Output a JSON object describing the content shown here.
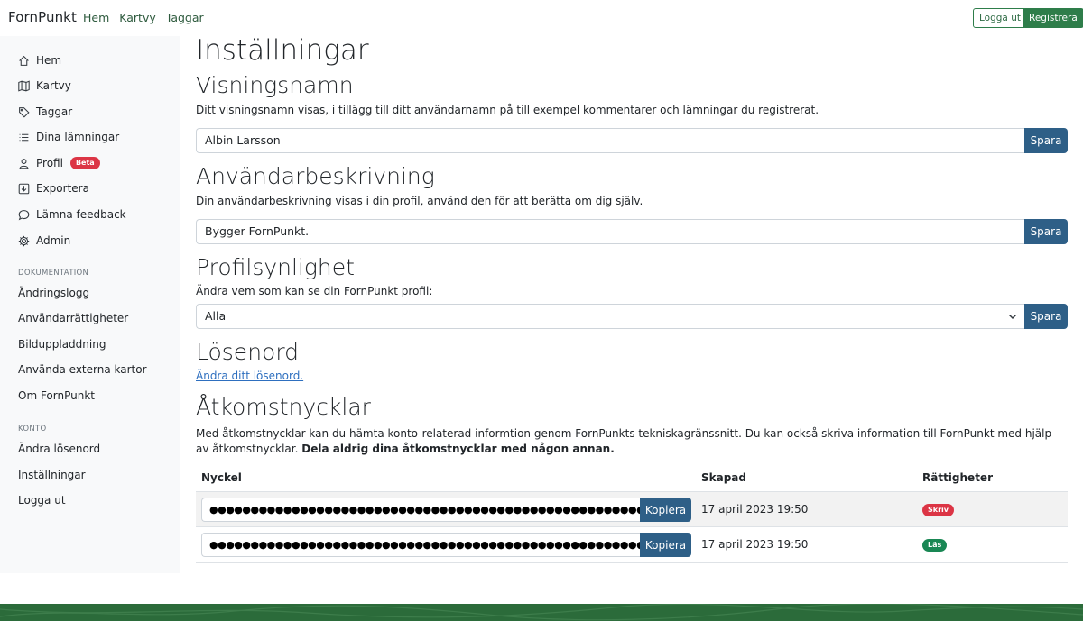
{
  "navbar": {
    "brand": "FornPunkt",
    "links": [
      "Hem",
      "Kartvy",
      "Taggar"
    ],
    "logout": "Logga ut",
    "register": "Registrera"
  },
  "sidebar": {
    "items": [
      {
        "label": "Hem",
        "icon": "home-icon"
      },
      {
        "label": "Kartvy",
        "icon": "map-icon"
      },
      {
        "label": "Taggar",
        "icon": "tag-icon"
      },
      {
        "label": "Dina lämningar",
        "icon": "list-icon"
      },
      {
        "label": "Profil",
        "icon": "user-icon",
        "badge": "Beta"
      },
      {
        "label": "Exportera",
        "icon": "download-icon"
      },
      {
        "label": "Lämna feedback",
        "icon": "chat-icon"
      },
      {
        "label": "Admin",
        "icon": "gear-icon"
      }
    ],
    "doc_heading": "DOKUMENTATION",
    "doc_links": [
      "Ändringslogg",
      "Användarrättigheter",
      "Bilduppladdning",
      "Använda externa kartor",
      "Om FornPunkt"
    ],
    "account_heading": "KONTO",
    "account_links": [
      "Ändra lösenord",
      "Inställningar",
      "Logga ut"
    ]
  },
  "main": {
    "title": "Inställningar",
    "display_name": {
      "heading": "Visningsnamn",
      "description": "Ditt visningsnamn visas, i tillägg till ditt användarnamn på till exempel kommentarer och lämningar du registrerat.",
      "value": "Albin Larsson",
      "save": "Spara"
    },
    "user_description": {
      "heading": "Användarbeskrivning",
      "description": "Din användarbeskrivning visas i din profil, använd den för att berätta om dig själv.",
      "value": "Bygger FornPunkt.",
      "save": "Spara"
    },
    "visibility": {
      "heading": "Profilsynlighet",
      "description": "Ändra vem som kan se din FornPunkt profil:",
      "selected": "Alla",
      "save": "Spara"
    },
    "password": {
      "heading": "Lösenord",
      "link": "Ändra ditt lösenord."
    },
    "access_keys": {
      "heading": "Åtkomstnycklar",
      "description_line1": "Med åtkomstnycklar kan du hämta konto-relaterad informtion genom FornPunkts tekniskagränssnitt. Du kan också skriva information till FornPunkt med hjälp av åtkomstnycklar.",
      "warning_part1": "Dela aldrig",
      "warning_part2": "dina åtkomstnycklar med någon annan.",
      "columns": [
        "Nyckel",
        "Skapad",
        "Rättigheter"
      ],
      "rows": [
        {
          "key": "●●●●●●●●●●●●●●●●●●●●●●●●●●●●●●●●●●●●●●●●●●●●●●●●●●●●●●●●●●●●●●●●",
          "copy": "Kopiera",
          "created": "17 april 2023 19:50",
          "permission": "Skriv",
          "permission_color": "#dc3545"
        },
        {
          "key": "●●●●●●●●●●●●●●●●●●●●●●●●●●●●●●●●●●●●●●●●●●●●●●●●●●●●●●●●●●●●●●●●",
          "copy": "Kopiera",
          "created": "17 april 2023 19:50",
          "permission": "Läs",
          "permission_color": "#198754"
        }
      ]
    }
  },
  "colors": {
    "primary_green": "#2e7d4a",
    "button_blue": "#2e5f87",
    "footer_green": "#2b6b3a"
  }
}
